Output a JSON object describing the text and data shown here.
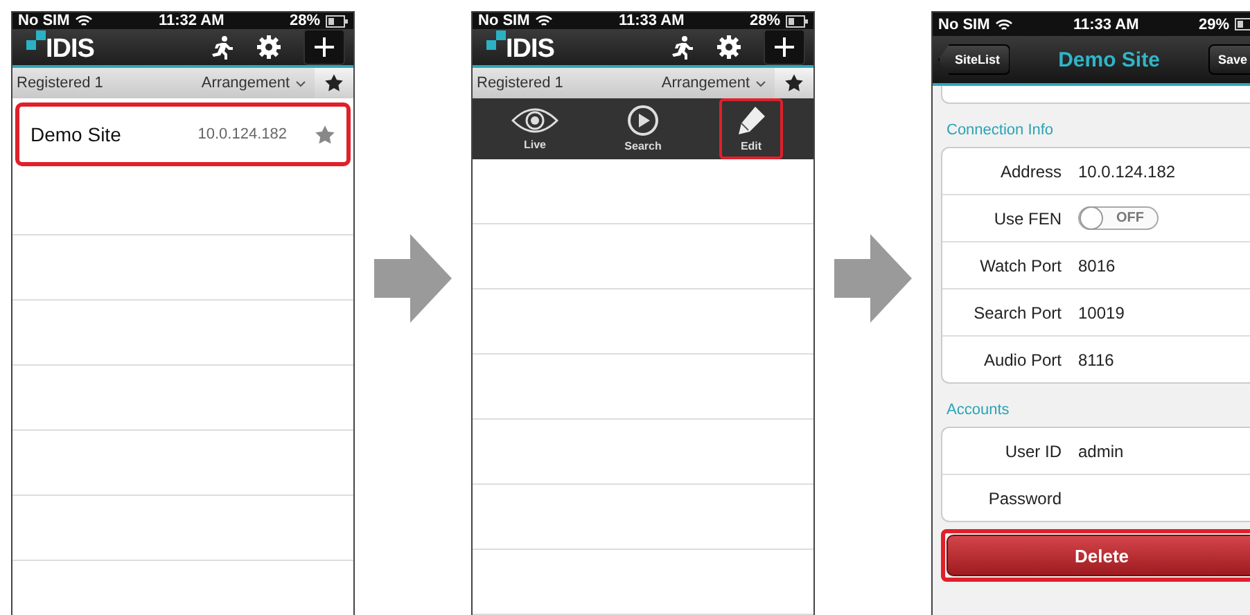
{
  "screens": [
    {
      "kind": "site_list",
      "status_bar": {
        "carrier": "No SIM",
        "time": "11:32 AM",
        "battery": "28%"
      },
      "logo": "IDIS",
      "filter_bar": {
        "label": "Registered 1",
        "sort": "Arrangement"
      },
      "sites": [
        {
          "name": "Demo Site",
          "address": "10.0.124.182",
          "highlighted": true
        }
      ]
    },
    {
      "kind": "site_list",
      "status_bar": {
        "carrier": "No SIM",
        "time": "11:33 AM",
        "battery": "28%"
      },
      "logo": "IDIS",
      "filter_bar": {
        "label": "Registered 1",
        "sort": "Arrangement"
      },
      "actions": [
        {
          "kind": "eye",
          "label": "Live",
          "highlighted": false
        },
        {
          "kind": "play",
          "label": "Search",
          "highlighted": false
        },
        {
          "kind": "pencil",
          "label": "Edit",
          "highlighted": true
        }
      ]
    },
    {
      "kind": "site_edit",
      "status_bar": {
        "carrier": "No SIM",
        "time": "11:33 AM",
        "battery": "29%"
      },
      "back": "SiteList",
      "title": "Demo Site",
      "save": "Save",
      "sections": [
        {
          "title": "Connection Info",
          "rows": [
            {
              "kind": "text",
              "label": "Address",
              "value": "10.0.124.182"
            },
            {
              "kind": "toggle",
              "label": "Use FEN",
              "on": false,
              "state_label": "OFF"
            },
            {
              "kind": "text",
              "label": "Watch Port",
              "value": "8016"
            },
            {
              "kind": "text",
              "label": "Search Port",
              "value": "10019"
            },
            {
              "kind": "text",
              "label": "Audio Port",
              "value": "8116"
            }
          ]
        },
        {
          "title": "Accounts",
          "rows": [
            {
              "kind": "text",
              "label": "User ID",
              "value": "admin"
            },
            {
              "kind": "text",
              "label": "Password"
            }
          ]
        }
      ],
      "delete": {
        "label": "Delete",
        "highlighted": true
      }
    }
  ]
}
